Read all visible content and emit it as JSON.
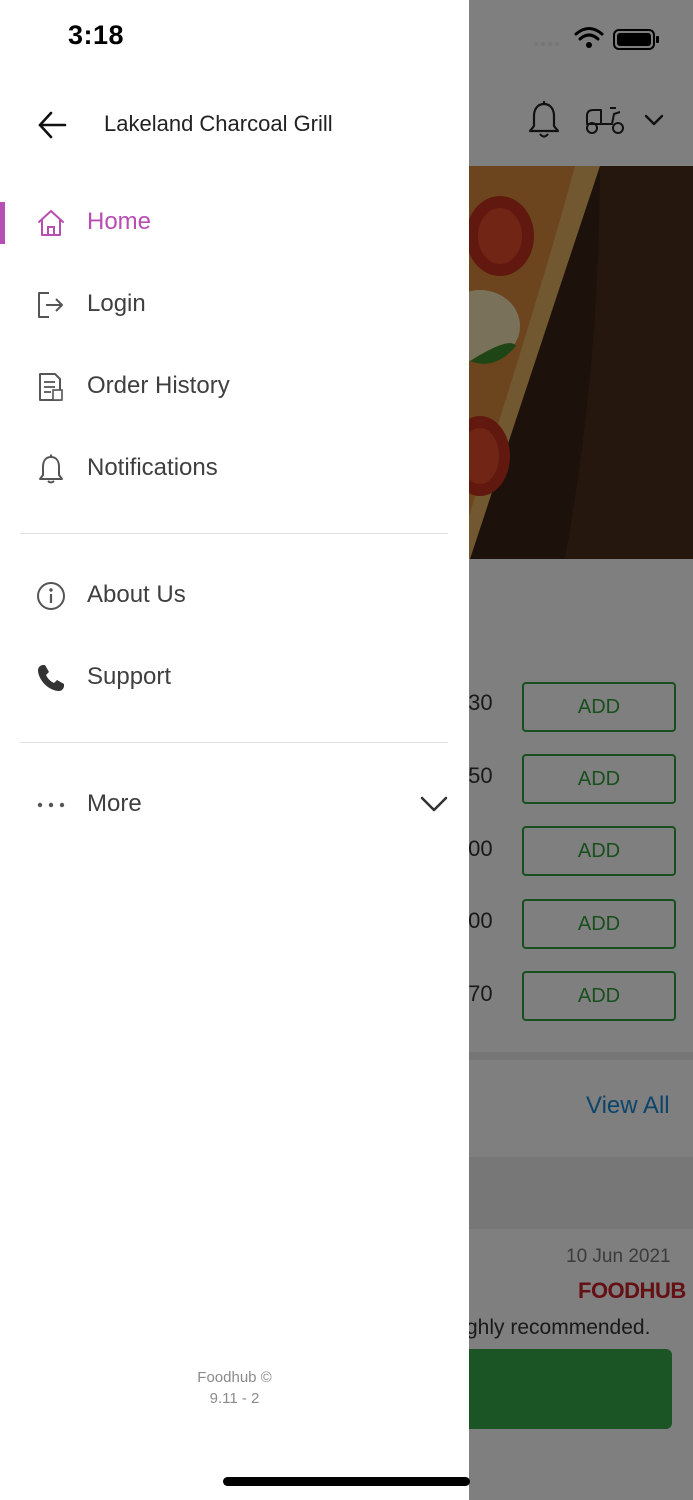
{
  "status_bar": {
    "time": "3:18"
  },
  "drawer": {
    "title": "Lakeland Charcoal Grill",
    "menu_primary": [
      {
        "label": "Home",
        "icon": "home-icon",
        "active": true
      },
      {
        "label": "Login",
        "icon": "login-icon"
      },
      {
        "label": "Order History",
        "icon": "order-history-icon"
      },
      {
        "label": "Notifications",
        "icon": "bell-icon"
      }
    ],
    "menu_secondary": [
      {
        "label": "About Us",
        "icon": "info-icon"
      },
      {
        "label": "Support",
        "icon": "phone-icon"
      }
    ],
    "more": {
      "label": "More",
      "icon": "ellipsis-icon"
    },
    "footer": {
      "line1": "Foodhub ©",
      "line2": "9.11 - 2"
    },
    "accent_color": "#b84db4"
  },
  "background": {
    "prices": [
      ".30",
      ".50",
      ".00",
      ".00",
      ".70"
    ],
    "add_label": "ADD",
    "view_all": "View All",
    "review_date": "10 Jun 2021",
    "brand": "FOODHUB",
    "review_text": "ghly recommended.",
    "green": "#2e9e3a"
  }
}
